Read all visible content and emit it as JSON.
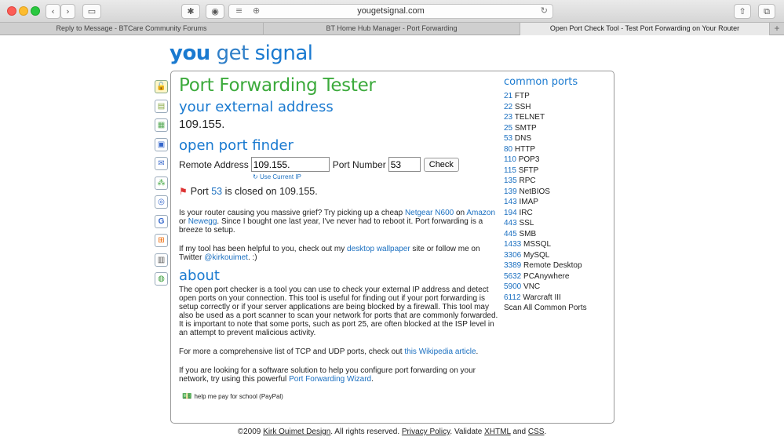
{
  "browser": {
    "url": "yougetsignal.com",
    "tabs": [
      {
        "label": "Reply to Message - BTCare Community Forums"
      },
      {
        "label": "BT Home Hub Manager - Port Forwarding"
      },
      {
        "label": "Open Port Check Tool - Test Port Forwarding on Your Router"
      }
    ]
  },
  "logo": {
    "you": "you",
    "get": "get",
    "signal": "signal"
  },
  "main": {
    "title": "Port Forwarding Tester",
    "external_heading": "your external address",
    "external_ip": "109.155.",
    "finder_heading": "open port finder",
    "remote_label": "Remote Address",
    "remote_value": "109.155.",
    "port_label": "Port Number",
    "port_value": "53",
    "check_label": "Check",
    "use_ip_label": "Use Current IP",
    "result": {
      "prefix": "Port",
      "port": "53",
      "middle": "is closed on",
      "ip": "109.155."
    },
    "promo": {
      "t1": "Is your router causing you massive grief? Try picking up a cheap",
      "l1": "Netgear N600",
      "t2": "on",
      "l2": "Amazon",
      "t3": "or",
      "l3": "Newegg",
      "t4": ". Since I bought one last year, I've never had to reboot it. Port forwarding is a breeze to setup."
    },
    "helpful": {
      "t1": "If my tool has been helpful to you, check out my",
      "l1": "desktop wallpaper",
      "t2": "site or follow me on Twitter",
      "l2": "@kirkouimet",
      "t3": ". :)"
    },
    "about_heading": "about",
    "about_text": "The open port checker is a tool you can use to check your external IP address and detect open ports on your connection. This tool is useful for finding out if your port forwarding is setup correctly or if your server applications are being blocked by a firewall. This tool may also be used as a port scanner to scan your network for ports that are commonly forwarded. It is important to note that some ports, such as port 25, are often blocked at the ISP level in an attempt to prevent malicious activity.",
    "wiki": {
      "t1": "For more a comprehensive list of TCP and UDP ports, check out",
      "l1": "this Wikipedia article",
      "t2": "."
    },
    "wizard": {
      "t1": "If you are looking for a software solution to help you configure port forwarding on your network, try using this powerful",
      "l1": "Port Forwarding Wizard",
      "t2": "."
    },
    "paypal_label": "help me pay for school (PayPal)"
  },
  "ports": {
    "title": "common ports",
    "items": [
      {
        "num": "21",
        "name": "FTP"
      },
      {
        "num": "22",
        "name": "SSH"
      },
      {
        "num": "23",
        "name": "TELNET"
      },
      {
        "num": "25",
        "name": "SMTP"
      },
      {
        "num": "53",
        "name": "DNS"
      },
      {
        "num": "80",
        "name": "HTTP"
      },
      {
        "num": "110",
        "name": "POP3"
      },
      {
        "num": "115",
        "name": "SFTP"
      },
      {
        "num": "135",
        "name": "RPC"
      },
      {
        "num": "139",
        "name": "NetBIOS"
      },
      {
        "num": "143",
        "name": "IMAP"
      },
      {
        "num": "194",
        "name": "IRC"
      },
      {
        "num": "443",
        "name": "SSL"
      },
      {
        "num": "445",
        "name": "SMB"
      },
      {
        "num": "1433",
        "name": "MSSQL"
      },
      {
        "num": "3306",
        "name": "MySQL"
      },
      {
        "num": "3389",
        "name": "Remote Desktop"
      },
      {
        "num": "5632",
        "name": "PCAnywhere"
      },
      {
        "num": "5900",
        "name": "VNC"
      },
      {
        "num": "6112",
        "name": "Warcraft III"
      }
    ],
    "scan_all": "Scan All Common Ports"
  },
  "footer": {
    "t1": "©2009",
    "l1": "Kirk Ouimet Design",
    "t2": ". All rights reserved.",
    "l2": "Privacy Policy",
    "t3": ". Validate",
    "l3": "XHTML",
    "t4": "and",
    "l4": "CSS",
    "t5": "."
  }
}
